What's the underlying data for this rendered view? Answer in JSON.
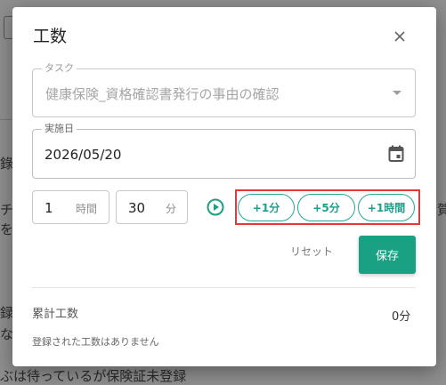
{
  "background": {
    "fragments": [
      "錄",
      "チ畠",
      "を",
      "録",
      "な",
      "ぶは待っているが保険証未登録",
      "賀"
    ]
  },
  "dialog": {
    "title": "工数",
    "task": {
      "label": "タスク",
      "placeholder": "健康保険_資格確認書発行の事由の確認"
    },
    "date": {
      "label": "実施日",
      "value": "2026/05/20"
    },
    "hours": {
      "value": "1",
      "unit": "時間"
    },
    "minutes": {
      "value": "30",
      "unit": "分"
    },
    "quick_add": [
      "+1分",
      "+5分",
      "+1時間"
    ],
    "reset_label": "リセット",
    "save_label": "保存",
    "total": {
      "label": "累計工数",
      "value": "0分"
    },
    "empty_message": "登録された工数はありません"
  },
  "colors": {
    "accent": "#1aa183",
    "highlight": "#e53935"
  },
  "icons": {
    "close": "close-icon",
    "calendar": "calendar-icon",
    "play": "play-icon",
    "dropdown": "chevron-down-icon"
  }
}
